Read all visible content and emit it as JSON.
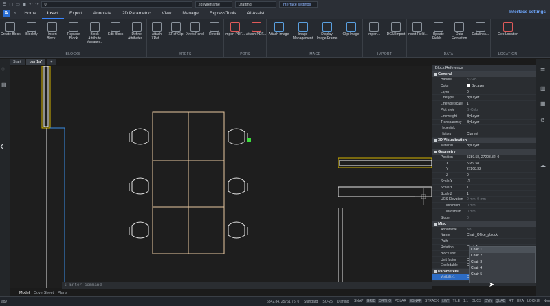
{
  "qat": {
    "layer": "0",
    "visual_style": "2dWireframe",
    "workspace": "Drafting",
    "search": "Interface settings"
  },
  "menu_tabs": [
    "Home",
    "Insert",
    "Export",
    "Annotate",
    "2D Parametric",
    "View",
    "Manage",
    "ExpressTools",
    "AI Assist"
  ],
  "active_tab": "Insert",
  "interface_settings": "Interface settings",
  "ribbon": {
    "blocks": {
      "title": "BLOCKS",
      "buttons": [
        "Create Block",
        "Blockify",
        "Insert Block...",
        "Replace Block",
        "Block Attribute Manager...",
        "Edit Block",
        "Define Attributes..."
      ]
    },
    "xrefs": {
      "title": "XREFS",
      "buttons": [
        "Attach XRef...",
        "XRef Clip",
        "Xrefs Panel",
        "Refedit"
      ]
    },
    "pdfs": {
      "title": "PDFS",
      "buttons": [
        "Import PDF...",
        "Attach PDF..."
      ]
    },
    "image": {
      "title": "IMAGE",
      "buttons": [
        "Attach Image",
        "Image Management",
        "Display Image Frame",
        "Clip Image"
      ]
    },
    "import": {
      "title": "IMPORT",
      "buttons": [
        "Import...",
        "DGN Import"
      ]
    },
    "data": {
      "title": "DATA",
      "buttons": [
        "Insert Field...",
        "Update Fields...",
        "Data Extraction",
        "Datalinks..."
      ]
    },
    "location": {
      "title": "LOCATION",
      "buttons": [
        "Geo Location"
      ]
    }
  },
  "doc_tabs": [
    "Start",
    "plan1a*"
  ],
  "command_placeholder": ": Enter command",
  "layout_tabs": [
    "Model",
    "CoverSheet",
    "Plans"
  ],
  "status": {
    "coords": "6842.84, 25761.75, 0",
    "std": "Standard",
    "scale": "ISO-25",
    "ws": "Drafting",
    "toggles": [
      "SNAP",
      "GRID",
      "ORTHO",
      "POLAR",
      "ESNAP",
      "STRACK",
      "LWT",
      "TILE",
      "1:1",
      "DUCS",
      "DYN",
      "QUAD",
      "RT",
      "HKA",
      "LOCKUI",
      "None"
    ]
  },
  "properties": {
    "header": "Block Reference",
    "sections": [
      {
        "title": "General",
        "rows": [
          [
            "Handle",
            "3334B"
          ],
          [
            "Color",
            "ByLayer"
          ],
          [
            "Layer",
            "0"
          ],
          [
            "Linetype",
            "ByLayer"
          ],
          [
            "Linetype scale",
            "1"
          ],
          [
            "Plot style",
            "ByColor"
          ],
          [
            "Lineweight",
            "ByLayer"
          ],
          [
            "Transparency",
            "ByLayer"
          ],
          [
            "Hyperlink",
            ""
          ],
          [
            "History",
            "Current"
          ]
        ]
      },
      {
        "title": "3D Visualization",
        "rows": [
          [
            "Material",
            "ByLayer"
          ]
        ]
      },
      {
        "title": "Geometry",
        "rows": [
          [
            "Position",
            "5389.58, 27208.32, 0"
          ],
          [
            "X",
            "5389.58"
          ],
          [
            "Y",
            "27208.32"
          ],
          [
            "Z",
            "0"
          ],
          [
            "Scale X",
            "-1"
          ],
          [
            "Scale Y",
            "1"
          ],
          [
            "Scale Z",
            "1"
          ],
          [
            "UCS Elevation",
            "0 mm, 0 mm"
          ],
          [
            "Minimum",
            "0 mm"
          ],
          [
            "Maximum",
            "0 mm"
          ],
          [
            "Slope",
            "0"
          ]
        ]
      },
      {
        "title": "Misc",
        "rows": [
          [
            "Annotative",
            "No"
          ],
          [
            "Name",
            "Chair_Office_pblock"
          ],
          [
            "Path",
            ""
          ],
          [
            "Rotation",
            "Chair 1"
          ],
          [
            "Block unit",
            "Chair 2"
          ],
          [
            "Unit factor",
            "Chair 3"
          ],
          [
            "Explodable",
            "Chair 4"
          ]
        ]
      },
      {
        "title": "Parameters",
        "rows": [
          [
            "Visibility1",
            "Chair 1"
          ]
        ]
      }
    ],
    "visibility_options": [
      "Chair 1",
      "Chair 2",
      "Chair 3",
      "Chair 4",
      "Chair 5"
    ]
  }
}
